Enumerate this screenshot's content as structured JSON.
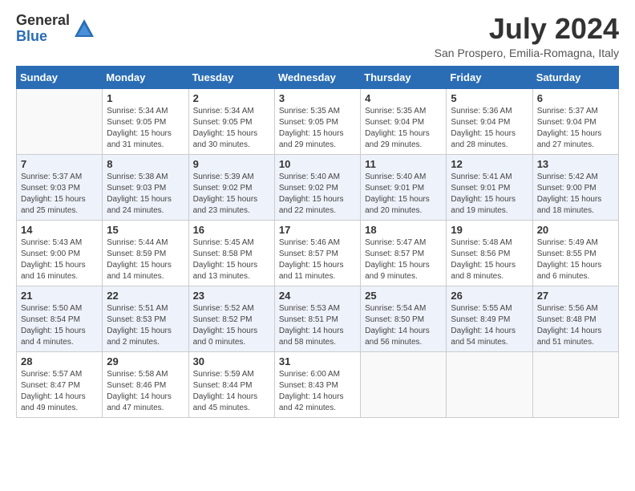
{
  "logo": {
    "general": "General",
    "blue": "Blue"
  },
  "title": "July 2024",
  "subtitle": "San Prospero, Emilia-Romagna, Italy",
  "days_header": [
    "Sunday",
    "Monday",
    "Tuesday",
    "Wednesday",
    "Thursday",
    "Friday",
    "Saturday"
  ],
  "weeks": [
    [
      {
        "num": "",
        "info": ""
      },
      {
        "num": "1",
        "info": "Sunrise: 5:34 AM\nSunset: 9:05 PM\nDaylight: 15 hours\nand 31 minutes."
      },
      {
        "num": "2",
        "info": "Sunrise: 5:34 AM\nSunset: 9:05 PM\nDaylight: 15 hours\nand 30 minutes."
      },
      {
        "num": "3",
        "info": "Sunrise: 5:35 AM\nSunset: 9:05 PM\nDaylight: 15 hours\nand 29 minutes."
      },
      {
        "num": "4",
        "info": "Sunrise: 5:35 AM\nSunset: 9:04 PM\nDaylight: 15 hours\nand 29 minutes."
      },
      {
        "num": "5",
        "info": "Sunrise: 5:36 AM\nSunset: 9:04 PM\nDaylight: 15 hours\nand 28 minutes."
      },
      {
        "num": "6",
        "info": "Sunrise: 5:37 AM\nSunset: 9:04 PM\nDaylight: 15 hours\nand 27 minutes."
      }
    ],
    [
      {
        "num": "7",
        "info": "Sunrise: 5:37 AM\nSunset: 9:03 PM\nDaylight: 15 hours\nand 25 minutes."
      },
      {
        "num": "8",
        "info": "Sunrise: 5:38 AM\nSunset: 9:03 PM\nDaylight: 15 hours\nand 24 minutes."
      },
      {
        "num": "9",
        "info": "Sunrise: 5:39 AM\nSunset: 9:02 PM\nDaylight: 15 hours\nand 23 minutes."
      },
      {
        "num": "10",
        "info": "Sunrise: 5:40 AM\nSunset: 9:02 PM\nDaylight: 15 hours\nand 22 minutes."
      },
      {
        "num": "11",
        "info": "Sunrise: 5:40 AM\nSunset: 9:01 PM\nDaylight: 15 hours\nand 20 minutes."
      },
      {
        "num": "12",
        "info": "Sunrise: 5:41 AM\nSunset: 9:01 PM\nDaylight: 15 hours\nand 19 minutes."
      },
      {
        "num": "13",
        "info": "Sunrise: 5:42 AM\nSunset: 9:00 PM\nDaylight: 15 hours\nand 18 minutes."
      }
    ],
    [
      {
        "num": "14",
        "info": "Sunrise: 5:43 AM\nSunset: 9:00 PM\nDaylight: 15 hours\nand 16 minutes."
      },
      {
        "num": "15",
        "info": "Sunrise: 5:44 AM\nSunset: 8:59 PM\nDaylight: 15 hours\nand 14 minutes."
      },
      {
        "num": "16",
        "info": "Sunrise: 5:45 AM\nSunset: 8:58 PM\nDaylight: 15 hours\nand 13 minutes."
      },
      {
        "num": "17",
        "info": "Sunrise: 5:46 AM\nSunset: 8:57 PM\nDaylight: 15 hours\nand 11 minutes."
      },
      {
        "num": "18",
        "info": "Sunrise: 5:47 AM\nSunset: 8:57 PM\nDaylight: 15 hours\nand 9 minutes."
      },
      {
        "num": "19",
        "info": "Sunrise: 5:48 AM\nSunset: 8:56 PM\nDaylight: 15 hours\nand 8 minutes."
      },
      {
        "num": "20",
        "info": "Sunrise: 5:49 AM\nSunset: 8:55 PM\nDaylight: 15 hours\nand 6 minutes."
      }
    ],
    [
      {
        "num": "21",
        "info": "Sunrise: 5:50 AM\nSunset: 8:54 PM\nDaylight: 15 hours\nand 4 minutes."
      },
      {
        "num": "22",
        "info": "Sunrise: 5:51 AM\nSunset: 8:53 PM\nDaylight: 15 hours\nand 2 minutes."
      },
      {
        "num": "23",
        "info": "Sunrise: 5:52 AM\nSunset: 8:52 PM\nDaylight: 15 hours\nand 0 minutes."
      },
      {
        "num": "24",
        "info": "Sunrise: 5:53 AM\nSunset: 8:51 PM\nDaylight: 14 hours\nand 58 minutes."
      },
      {
        "num": "25",
        "info": "Sunrise: 5:54 AM\nSunset: 8:50 PM\nDaylight: 14 hours\nand 56 minutes."
      },
      {
        "num": "26",
        "info": "Sunrise: 5:55 AM\nSunset: 8:49 PM\nDaylight: 14 hours\nand 54 minutes."
      },
      {
        "num": "27",
        "info": "Sunrise: 5:56 AM\nSunset: 8:48 PM\nDaylight: 14 hours\nand 51 minutes."
      }
    ],
    [
      {
        "num": "28",
        "info": "Sunrise: 5:57 AM\nSunset: 8:47 PM\nDaylight: 14 hours\nand 49 minutes."
      },
      {
        "num": "29",
        "info": "Sunrise: 5:58 AM\nSunset: 8:46 PM\nDaylight: 14 hours\nand 47 minutes."
      },
      {
        "num": "30",
        "info": "Sunrise: 5:59 AM\nSunset: 8:44 PM\nDaylight: 14 hours\nand 45 minutes."
      },
      {
        "num": "31",
        "info": "Sunrise: 6:00 AM\nSunset: 8:43 PM\nDaylight: 14 hours\nand 42 minutes."
      },
      {
        "num": "",
        "info": ""
      },
      {
        "num": "",
        "info": ""
      },
      {
        "num": "",
        "info": ""
      }
    ]
  ]
}
